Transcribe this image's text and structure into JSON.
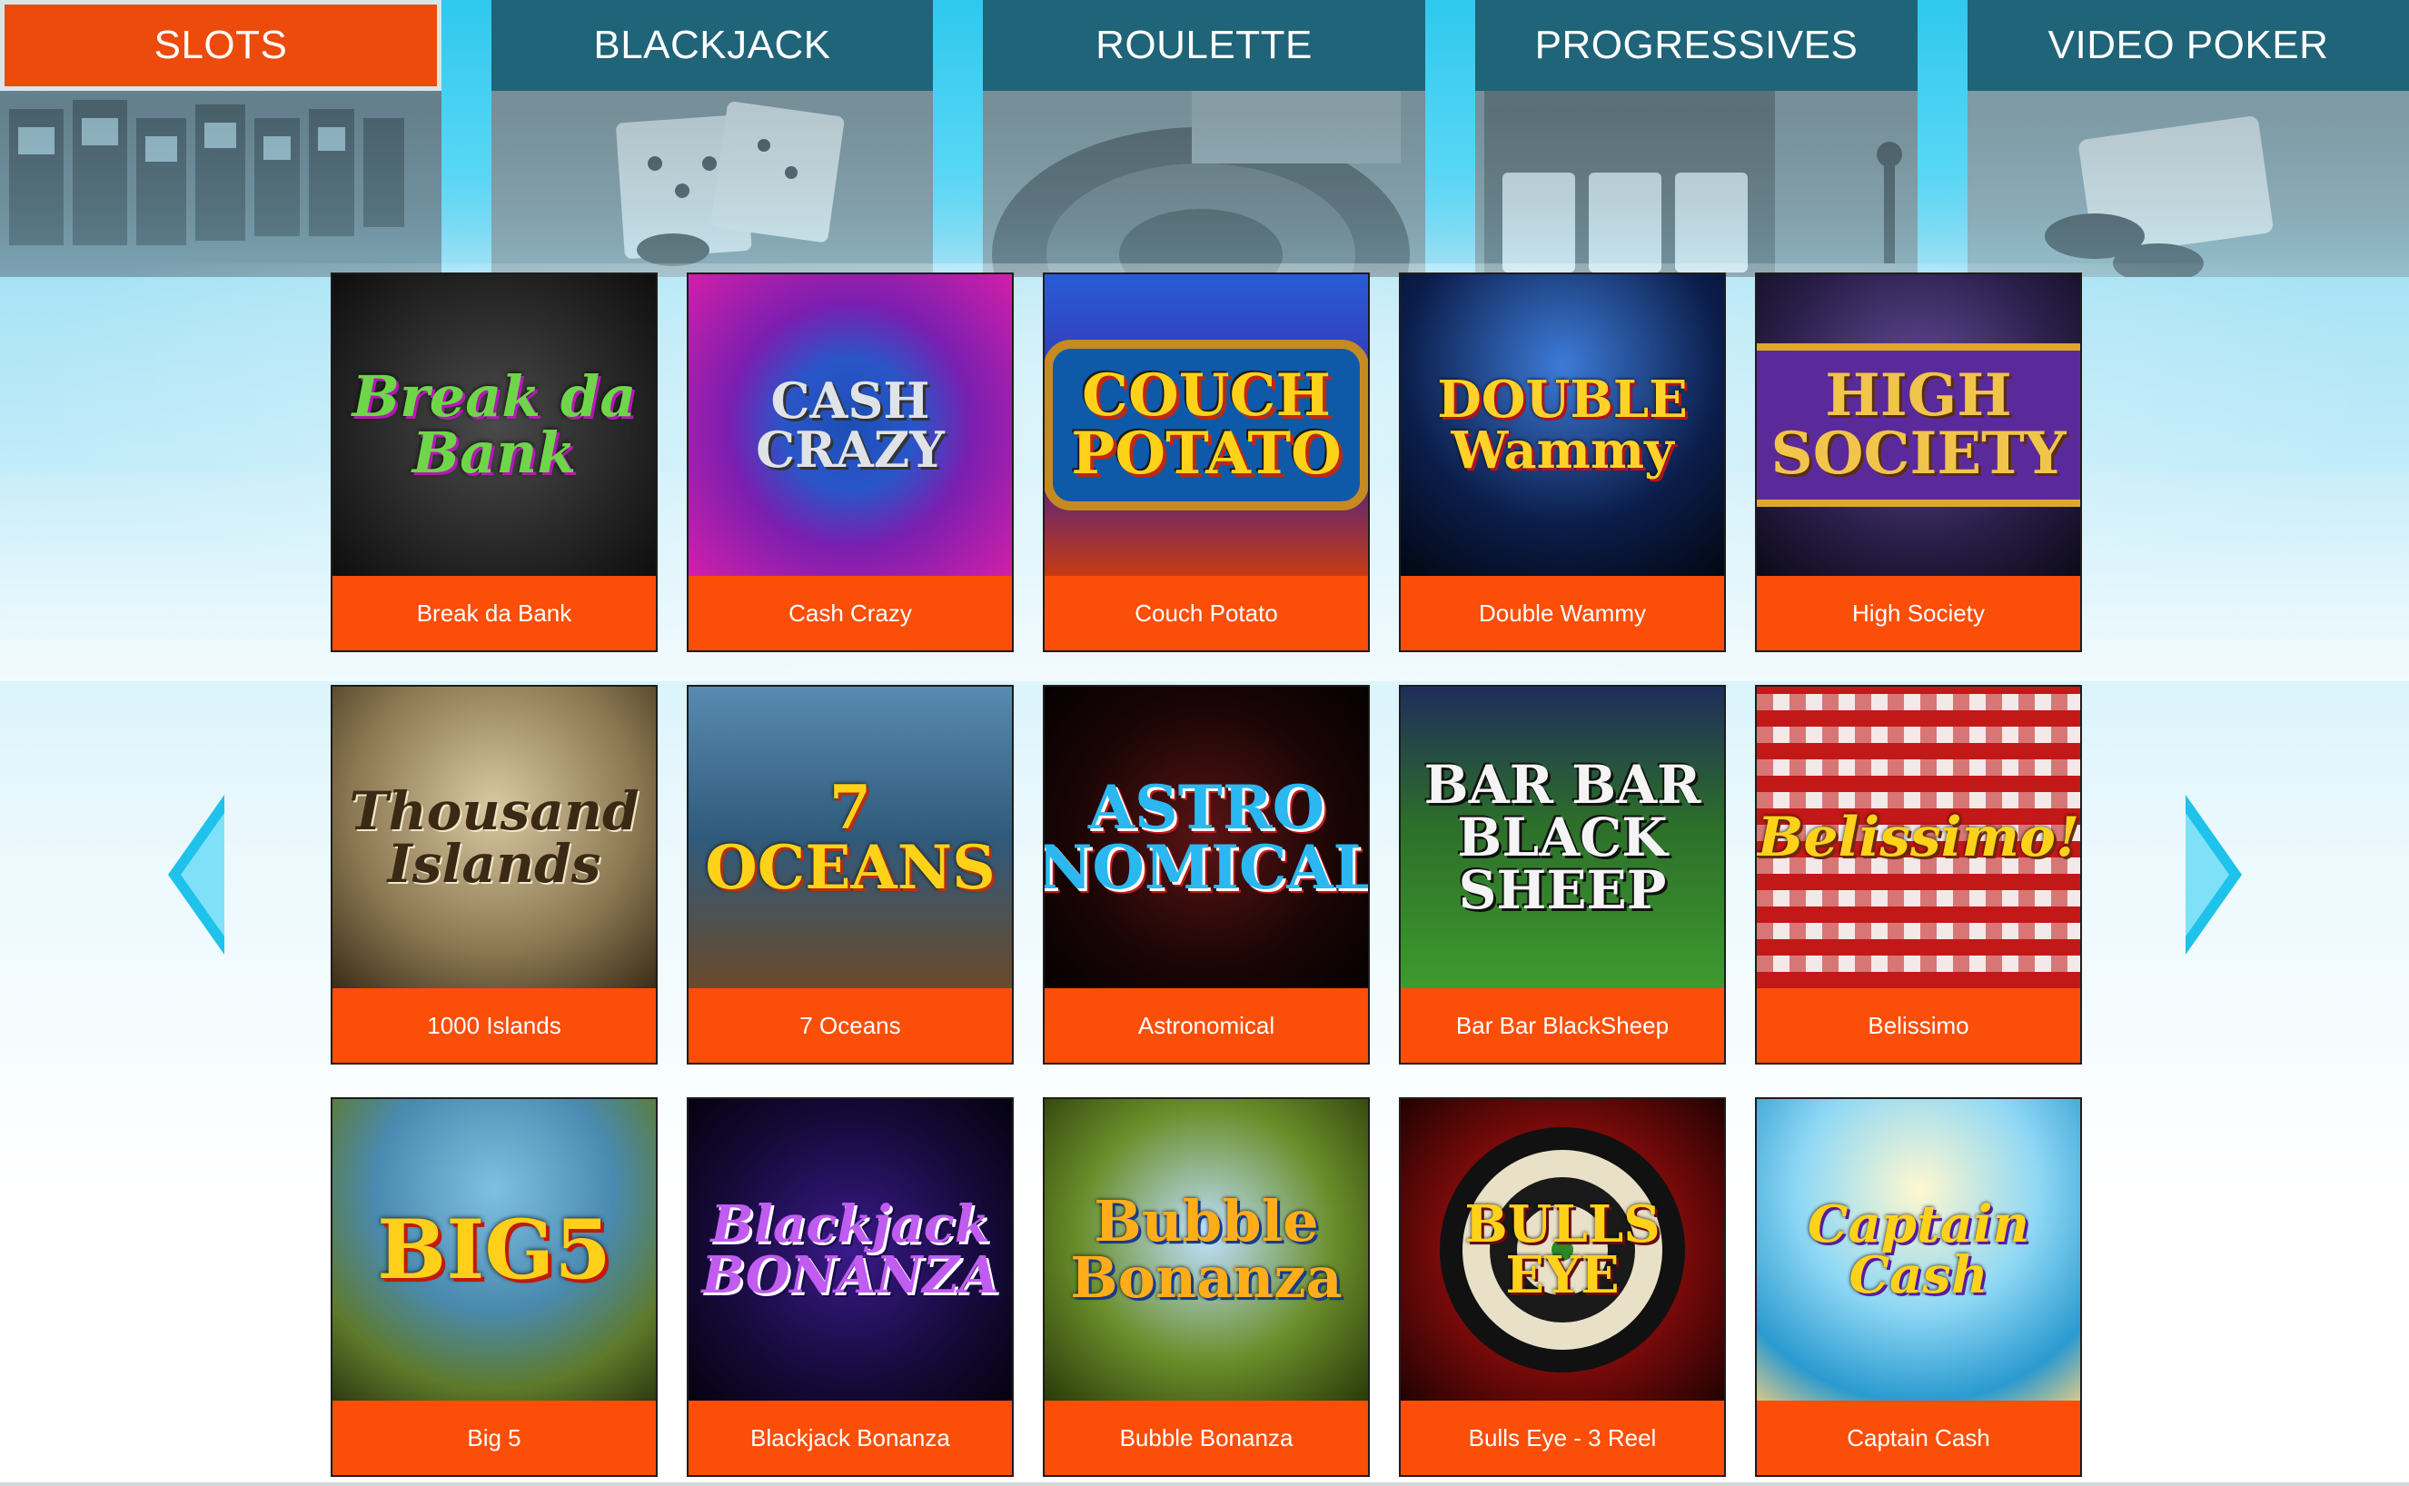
{
  "categories": [
    {
      "label": "SLOTS",
      "active": true
    },
    {
      "label": "BLACKJACK",
      "active": false
    },
    {
      "label": "ROULETTE",
      "active": false
    },
    {
      "label": "PROGRESSIVES",
      "active": false
    },
    {
      "label": "VIDEO POKER",
      "active": false
    }
  ],
  "games": [
    {
      "name": "Break da Bank",
      "logo": "Break da Bank"
    },
    {
      "name": "Cash Crazy",
      "logo": "CASH CRAZY"
    },
    {
      "name": "Couch Potato",
      "logo": "COUCH POTATO"
    },
    {
      "name": "Double Wammy",
      "logo": "DOUBLE Wammy"
    },
    {
      "name": "High Society",
      "logo": "HIGH SOCIETY"
    },
    {
      "name": "1000 Islands",
      "logo": "Thousand Islands"
    },
    {
      "name": "7 Oceans",
      "logo": "7 OCEANS"
    },
    {
      "name": "Astronomical",
      "logo": "ASTRO NOMICAL"
    },
    {
      "name": "Bar Bar BlackSheep",
      "logo": "BAR BAR BLACK SHEEP"
    },
    {
      "name": "Belissimo",
      "logo": "Belissimo!"
    },
    {
      "name": "Big 5",
      "logo": "BIG5"
    },
    {
      "name": "Blackjack Bonanza",
      "logo": "Blackjack BONANZA"
    },
    {
      "name": "Bubble Bonanza",
      "logo": "Bubble Bonanza"
    },
    {
      "name": "Bulls Eye - 3 Reel",
      "logo": "BULLS EYE"
    },
    {
      "name": "Captain Cash",
      "logo": "Captain Cash"
    }
  ],
  "colors": {
    "tab_bg": "#1f6478",
    "tab_active": "#ec4b0c",
    "label_bg": "#fb4e08",
    "arrow": "#1fc2ea"
  },
  "icons": {
    "prev": "chevron-left-icon",
    "next": "chevron-right-icon"
  }
}
